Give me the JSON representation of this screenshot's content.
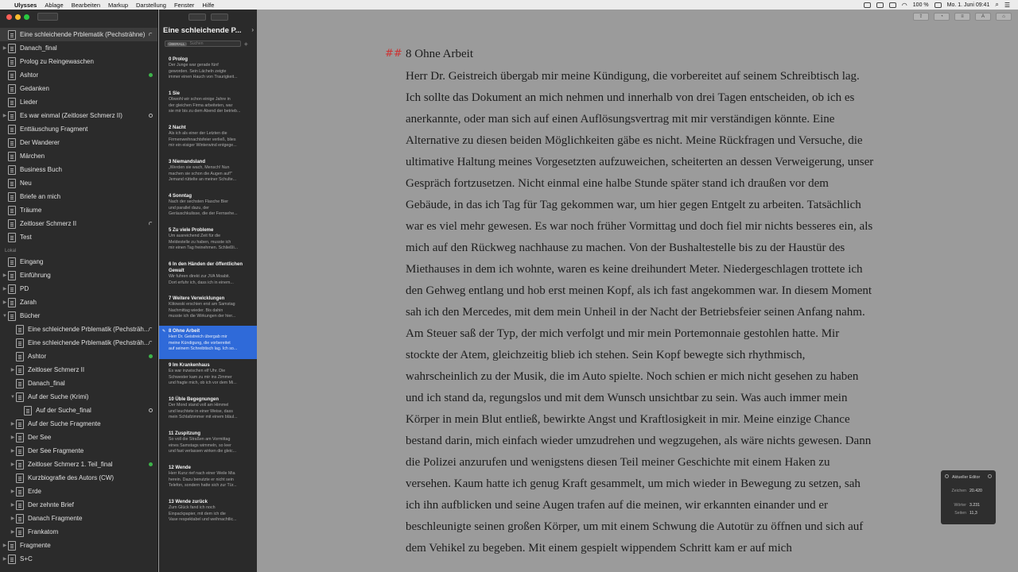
{
  "menubar": {
    "app": "Ulysses",
    "menus": [
      "Ablage",
      "Bearbeiten",
      "Markup",
      "Darstellung",
      "Fenster",
      "Hilfe"
    ],
    "battery": "100 %",
    "datetime": "Mo. 1. Juni 09:41"
  },
  "library": {
    "top_items": [
      {
        "label": "Eine schleichende Prblematik (Pechsträhne)",
        "status": "arc",
        "selected": true
      },
      {
        "label": "Danach_final",
        "status": ""
      },
      {
        "label": "Prolog zu Reingewaschen",
        "status": ""
      },
      {
        "label": "Ashtor",
        "status": "green"
      },
      {
        "label": "Gedanken",
        "status": ""
      },
      {
        "label": "Lieder",
        "status": ""
      },
      {
        "label": "Es war einmal (Zeitloser Schmerz II)",
        "status": "ring"
      },
      {
        "label": "Enttäuschung Fragment",
        "status": ""
      },
      {
        "label": "Der Wanderer",
        "status": ""
      },
      {
        "label": "Märchen",
        "status": ""
      },
      {
        "label": "Business Buch",
        "status": ""
      },
      {
        "label": "Neu",
        "status": ""
      },
      {
        "label": "Briefe an mich",
        "status": ""
      },
      {
        "label": "Träume",
        "status": ""
      },
      {
        "label": "Zeitloser Schmerz II",
        "status": "arc"
      },
      {
        "label": "Test",
        "status": ""
      }
    ],
    "local_label": "Lokal",
    "local_items": [
      {
        "label": "Eingang",
        "indent": 0,
        "chevron": ""
      },
      {
        "label": "Einführung",
        "indent": 0,
        "chevron": "▶"
      },
      {
        "label": "PD",
        "indent": 0,
        "chevron": "▶"
      },
      {
        "label": "Zarah",
        "indent": 0,
        "chevron": "▶"
      },
      {
        "label": "Bücher",
        "indent": 0,
        "chevron": "▼"
      },
      {
        "label": "Eine schleichende Prblematik (Pechsträh...",
        "indent": 1,
        "chevron": "",
        "status": "arc"
      },
      {
        "label": "Eine schleichende Prblematik (Pechsträh...",
        "indent": 1,
        "chevron": "",
        "status": "arc"
      },
      {
        "label": "Ashtor",
        "indent": 1,
        "chevron": "",
        "status": "green"
      },
      {
        "label": "Zeitloser Schmerz II",
        "indent": 1,
        "chevron": "▶"
      },
      {
        "label": "Danach_final",
        "indent": 1,
        "chevron": ""
      },
      {
        "label": "Auf der Suche (Krimi)",
        "indent": 1,
        "chevron": "▼"
      },
      {
        "label": "Auf der Suche_final",
        "indent": 2,
        "chevron": "",
        "status": "ring"
      },
      {
        "label": "Auf der Suche Fragmente",
        "indent": 1,
        "chevron": "▶"
      },
      {
        "label": "Der See",
        "indent": 1,
        "chevron": "▶"
      },
      {
        "label": "Der See Fragmente",
        "indent": 1,
        "chevron": "▶"
      },
      {
        "label": "Zeitloser Schmerz 1. Teil_final",
        "indent": 1,
        "chevron": "▶",
        "status": "green"
      },
      {
        "label": "Kurzbiografie des Autors (CW)",
        "indent": 1,
        "chevron": ""
      },
      {
        "label": "Erde",
        "indent": 1,
        "chevron": "▶"
      },
      {
        "label": "Der zehnte Brief",
        "indent": 1,
        "chevron": "▶"
      },
      {
        "label": "Danach Fragmente",
        "indent": 1,
        "chevron": "▶"
      },
      {
        "label": "Frankatom",
        "indent": 1,
        "chevron": "▶"
      },
      {
        "label": "Fragmente",
        "indent": 0,
        "chevron": "▶"
      },
      {
        "label": "S+C",
        "indent": 0,
        "chevron": "▶"
      }
    ]
  },
  "sheets": {
    "group_title": "Eine schleichende P...",
    "filter_pill": "ÜBERALL",
    "search_placeholder": "Suchen",
    "items": [
      {
        "title": "0 Prolog",
        "lines": [
          "Der Junge war gerade fünf",
          "geworden. Sein Lächeln zeigte",
          "immer einen Hauch von Traurigkeit..."
        ]
      },
      {
        "title": "1 Sie",
        "lines": [
          "Obwohl wir schon einige Jahre in",
          "der gleichen Firma arbeiteten, war",
          "sie mir bis zu dem Abend der betrieb..."
        ]
      },
      {
        "title": "2 Nacht",
        "lines": [
          "Als ich als einer der Letzten die",
          "Firmenweihnachtsfeier verließ, blies",
          "mir ein eisiger Winterwind entgege..."
        ]
      },
      {
        "title": "3 Niemandsland",
        "lines": [
          "„Werden sie wach, Mensch! Nun",
          "machen sie schon die Augen auf!\"",
          "Jemand rüttelte an meiner Schulte..."
        ]
      },
      {
        "title": "4 Sonntag",
        "lines": [
          "Nach der sechsten Flasche Bier",
          "und parallel dazu, der",
          "Geräuschkulisse, die der Fernsehe..."
        ]
      },
      {
        "title": "5 Zu viele Probleme",
        "lines": [
          "Um ausreichend Zeit für die",
          "Meldestelle zu haben, musste ich",
          "mir einen Tag freinehmen. Schließli..."
        ]
      },
      {
        "title": "6 In den Händen der öffentlichen Gewalt",
        "lines": [
          "Wir fuhren direkt zur JVA Moabit.",
          "Dort erfuhr ich, dass ich in einem..."
        ]
      },
      {
        "title": "7 Weitere Verwicklungen",
        "lines": [
          "Klitowski erschien erst am Samstag",
          "Nachmittag wieder. Bis dahin",
          "musste ich die Wirkungen der hier..."
        ]
      },
      {
        "title": "8 Ohne Arbeit",
        "lines": [
          "Herr Dr. Geistreich übergab mir",
          "meine Kündigung, die vorbereitet",
          "auf seinem Schreibtisch lag. Ich so..."
        ],
        "selected": true
      },
      {
        "title": "9 Im Krankenhaus",
        "lines": [
          "Es war inzwischen elf Uhr. Die",
          "Schwester kam zu mir ins Zimmer",
          "und fragte mich, ob ich vor dem Mi..."
        ]
      },
      {
        "title": "10 Üble Begegnungen",
        "lines": [
          "Der Mond stand voll am Himmel",
          "und leuchtete in einer Weise, dass",
          "mein Schlafzimmer mit einem bläul..."
        ]
      },
      {
        "title": "11 Zuspitzung",
        "lines": [
          "So voll die Straßen am Vormittag",
          "eines Samstags wimmeln, so leer",
          "und fast verlassen wirken die gleic..."
        ]
      },
      {
        "title": "12 Wende",
        "lines": [
          "Herr Kunz rief nach einer Weile Mia",
          "herein. Dazu benutzte er nicht sein",
          "Telefon, sondern hatte sich zur Tür..."
        ]
      },
      {
        "title": "13 Wende zurück",
        "lines": [
          "Zum Glück fand ich noch",
          "Einpackpapier, mit dem ich die",
          "Vase respektabel und weihnachtlic..."
        ]
      }
    ]
  },
  "editor": {
    "heading_marker": "##",
    "heading": "8 Ohne Arbeit",
    "body": "Herr Dr. Geistreich übergab mir meine Kündigung, die vorbereitet auf seinem Schreibtisch lag. Ich sollte das Dokument an mich nehmen und innerhalb von drei Tagen entscheiden, ob ich es anerkannte, oder man sich auf einen Auflösungsvertrag mit mir verständigen könnte. Eine Alternative zu diesen beiden Möglichkeiten gäbe es nicht. Meine Rückfragen und Versuche, die ultimative Haltung meines Vorgesetzten aufzuweichen, scheiterten an dessen Verweigerung, unser Gespräch fortzusetzen. Nicht einmal eine halbe Stunde später stand ich draußen vor dem Gebäude, in das ich Tag für Tag gekommen war, um hier gegen Entgelt zu arbeiten. Tatsächlich war es viel mehr gewesen. Es war noch früher Vormittag und doch fiel mir nichts besseres ein, als mich auf den Rückweg nachhause zu machen. Von der Bushaltestelle bis zu der Haustür des Miethauses in dem ich wohnte, waren es keine dreihundert Meter. Niedergeschlagen trottete ich den Gehweg entlang und hob erst meinen Kopf, als ich fast angekommen war. In diesem Moment sah ich den Mercedes, mit dem mein Unheil in der Nacht der Betriebsfeier seinen Anfang nahm. Am Steuer saß der Typ, der mich verfolgt und mir mein Portemonnaie gestohlen hatte. Mir stockte der Atem, gleichzeitig blieb ich stehen. Sein Kopf bewegte sich rhythmisch, wahrscheinlich zu der Musik, die im Auto spielte. Noch schien er mich nicht gesehen zu haben und ich stand da, regungslos und mit dem Wunsch unsichtbar zu sein. Was auch immer mein Körper in mein Blut entließ, bewirkte Angst und Kraftlosigkeit in mir. Meine einzige Chance bestand darin, mich einfach wieder umzudrehen und wegzugehen, als wäre nichts gewesen. Dann die Polizei anzurufen und wenigstens diesen Teil meiner Geschichte mit einem Haken zu versehen. Kaum hatte ich genug Kraft gesammelt, um mich wieder in Bewegung zu setzen, sah ich ihn aufblicken und seine Augen trafen auf die meinen, wir erkannten einander und er beschleunigte seinen großen Körper, um mit einem Schwung die Autotür zu öffnen und sich auf dem Vehikel zu begeben. Mit einem gespielt wippendem Schritt kam er auf mich"
  },
  "stats": {
    "title": "Aktueller Editor",
    "chars_label": "Zeichen",
    "chars": "20.420",
    "words_label": "Wörter",
    "words": "3.231",
    "pages_label": "Seiten",
    "pages": "11,3"
  },
  "colors": {
    "accent": "#2f6ad9",
    "heading_marker": "#cc3333",
    "status_green": "#3db34a"
  }
}
